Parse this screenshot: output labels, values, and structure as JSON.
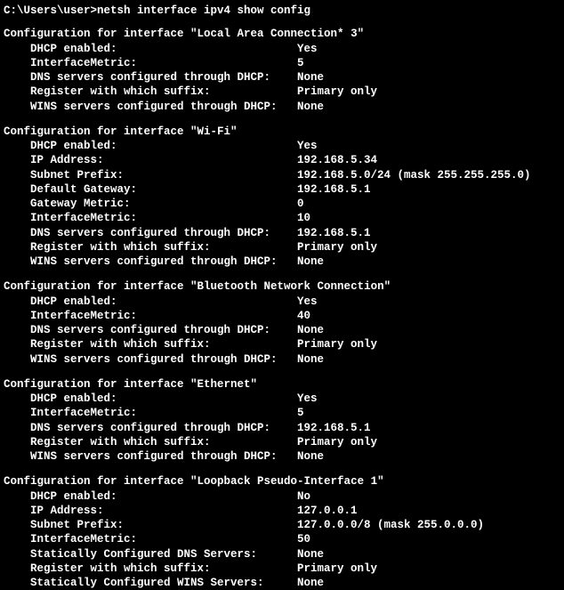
{
  "prompt": "C:\\Users\\user>netsh interface ipv4 show config",
  "interfaces": [
    {
      "header": "Configuration for interface \"Local Area Connection* 3\"",
      "rows": [
        {
          "k": "DHCP enabled:",
          "v": "Yes"
        },
        {
          "k": "InterfaceMetric:",
          "v": "5"
        },
        {
          "k": "DNS servers configured through DHCP:",
          "v": "None"
        },
        {
          "k": "Register with which suffix:",
          "v": "Primary only"
        },
        {
          "k": "WINS servers configured through DHCP:",
          "v": "None"
        }
      ]
    },
    {
      "header": "Configuration for interface \"Wi-Fi\"",
      "rows": [
        {
          "k": "DHCP enabled:",
          "v": "Yes"
        },
        {
          "k": "IP Address:",
          "v": "192.168.5.34"
        },
        {
          "k": "Subnet Prefix:",
          "v": "192.168.5.0/24 (mask 255.255.255.0)"
        },
        {
          "k": "Default Gateway:",
          "v": "192.168.5.1"
        },
        {
          "k": "Gateway Metric:",
          "v": "0"
        },
        {
          "k": "InterfaceMetric:",
          "v": "10"
        },
        {
          "k": "DNS servers configured through DHCP:",
          "v": "192.168.5.1"
        },
        {
          "k": "Register with which suffix:",
          "v": "Primary only"
        },
        {
          "k": "WINS servers configured through DHCP:",
          "v": "None"
        }
      ]
    },
    {
      "header": "Configuration for interface \"Bluetooth Network Connection\"",
      "rows": [
        {
          "k": "DHCP enabled:",
          "v": "Yes"
        },
        {
          "k": "InterfaceMetric:",
          "v": "40"
        },
        {
          "k": "DNS servers configured through DHCP:",
          "v": "None"
        },
        {
          "k": "Register with which suffix:",
          "v": "Primary only"
        },
        {
          "k": "WINS servers configured through DHCP:",
          "v": "None"
        }
      ]
    },
    {
      "header": "Configuration for interface \"Ethernet\"",
      "rows": [
        {
          "k": "DHCP enabled:",
          "v": "Yes"
        },
        {
          "k": "InterfaceMetric:",
          "v": "5"
        },
        {
          "k": "DNS servers configured through DHCP:",
          "v": "192.168.5.1"
        },
        {
          "k": "Register with which suffix:",
          "v": "Primary only"
        },
        {
          "k": "WINS servers configured through DHCP:",
          "v": "None"
        }
      ]
    },
    {
      "header": "Configuration for interface \"Loopback Pseudo-Interface 1\"",
      "rows": [
        {
          "k": "DHCP enabled:",
          "v": "No"
        },
        {
          "k": "IP Address:",
          "v": "127.0.0.1"
        },
        {
          "k": "Subnet Prefix:",
          "v": "127.0.0.0/8 (mask 255.0.0.0)"
        },
        {
          "k": "InterfaceMetric:",
          "v": "50"
        },
        {
          "k": "Statically Configured DNS Servers:",
          "v": "None"
        },
        {
          "k": "Register with which suffix:",
          "v": "Primary only"
        },
        {
          "k": "Statically Configured WINS Servers:",
          "v": "None"
        }
      ]
    }
  ]
}
